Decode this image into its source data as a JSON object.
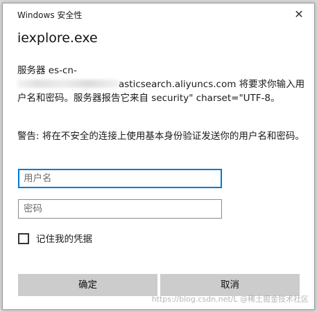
{
  "window": {
    "title": "Windows 安全性",
    "close_glyph": "✕"
  },
  "app": {
    "name": "iexplore.exe"
  },
  "message": {
    "line1": "服务器 es-cn-",
    "line2_rest": "asticsearch.aliyuncs.com 将要求你输入用户名和密码。服务器报告它来自 security\" charset=\"UTF-8。"
  },
  "warning": {
    "text": "警告: 将在不安全的连接上使用基本身份验证发送你的用户名和密码。"
  },
  "form": {
    "username_placeholder": "用户名",
    "username_value": "",
    "password_placeholder": "密码",
    "password_value": "",
    "remember_label": "记住我的凭据",
    "remember_checked": false
  },
  "buttons": {
    "ok_label": "确定",
    "cancel_label": "取消"
  },
  "watermark": {
    "text": "https://blog.csdn.net/L  @稀土掘金技术社区"
  },
  "colors": {
    "focus_border": "#0078d7",
    "button_bg": "#cccccc"
  }
}
